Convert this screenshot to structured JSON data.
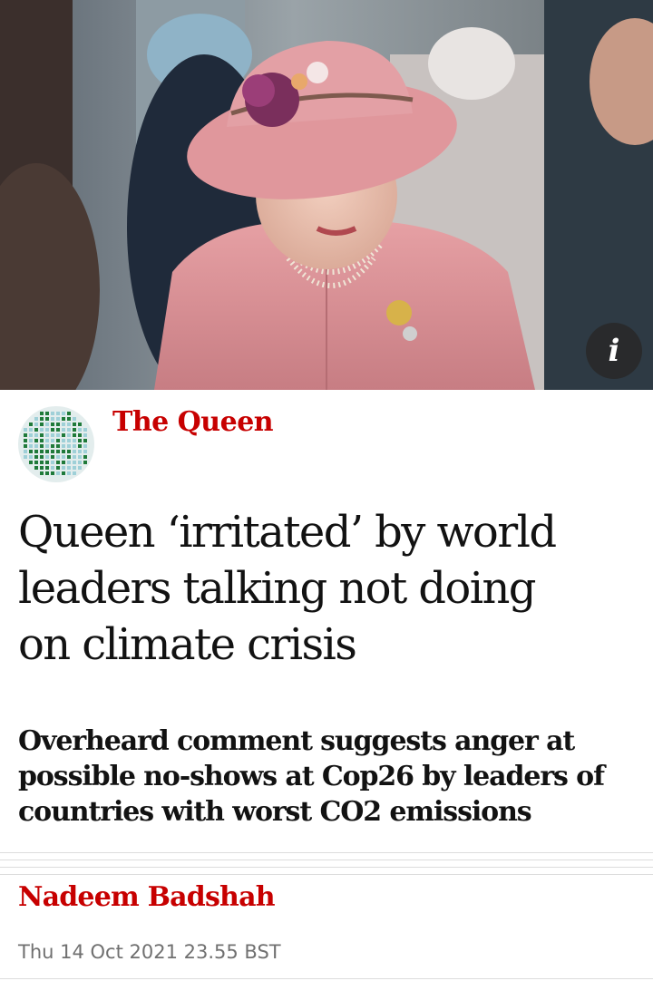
{
  "hero": {
    "info_glyph": "i",
    "info_icon": "info-icon"
  },
  "article": {
    "series_label": "The Queen",
    "series_icon": "globe-dots-icon",
    "headline_lines": [
      "Queen ‘irritated’ by world",
      "leaders talking not doing",
      "on climate crisis"
    ],
    "standfirst_lines": [
      "Overheard comment suggests anger at",
      "possible no-shows at Cop26 by leaders of",
      "countries with worst CO2 emissions"
    ],
    "byline": "Nadeem Badshah",
    "dateline": "Thu 14 Oct 2021 23.55 BST"
  },
  "colors": {
    "accent": "#c70000",
    "text": "#121212",
    "muted": "#707070",
    "rule": "#dcdcdc"
  }
}
